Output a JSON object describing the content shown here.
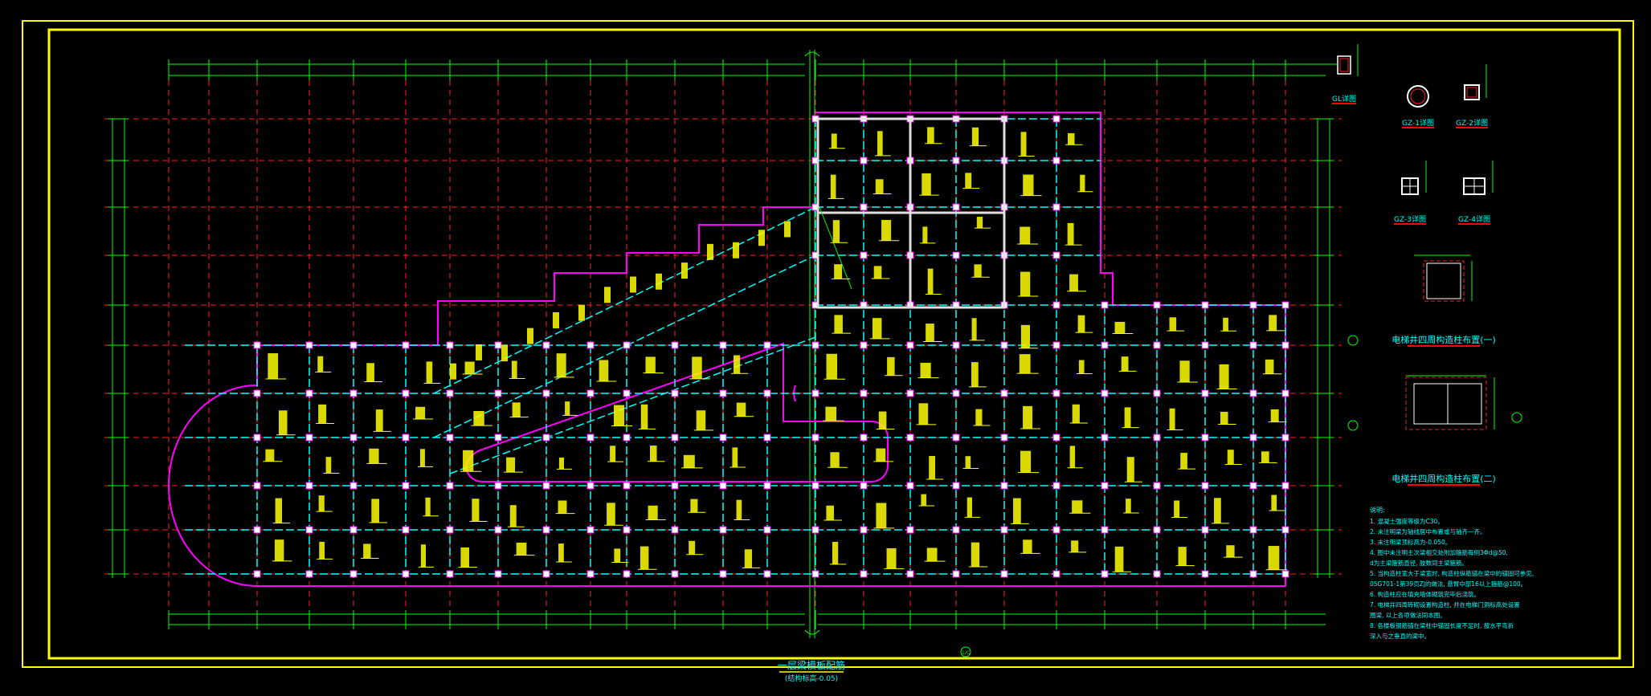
{
  "drawing": {
    "main_title": "一层梁模板配筋",
    "main_subtitle": "(结构标高-0.05)",
    "bubble_mark": "1/C",
    "colors": {
      "background": "#000000",
      "frame": "#ffff00",
      "grid": "#ff2020",
      "dimension": "#00ff00",
      "beam": "#00ffff",
      "wall": "#ff00ff",
      "text": "#ffff00",
      "column": "#ffffff",
      "title_underline": "#ff0000",
      "note_text": "#00ffff"
    }
  },
  "details": {
    "gl_title": "GL详图",
    "gz1_title": "GZ-1详图",
    "gz2_title": "GZ-2详图",
    "gz3_title": "GZ-3详图",
    "gz4_title": "GZ-4详图",
    "elevator1_title": "电梯井四周构造柱布置(一)",
    "elevator2_title": "电梯井四周构造柱布置(二)"
  },
  "notes": {
    "heading": "说明:",
    "items": [
      "1. 混凝土强度等级为C30。",
      "2. 未注明梁为轴线居中布置或与轴齐一齐。",
      "3. 未注明梁顶标高为-0.050。",
      "4. 图中未注明主次梁相交处附加箍筋每侧3Φd@50,",
      "   d为主梁箍筋直径, 肢数同主梁箍筋。",
      "5. 当构造柱宽大于梁宽时, 构造柱纵筋锚在梁中的锚固可参见,",
      "   05G701-1第39页ZJ的做法, 悬臂中部16以上箍筋@100。",
      "6. 构造柱应在填充墙体砌筑完毕后浇筑。",
      "7. 电梯井四周砖砌设置构造柱, 并在电梯门洞标高处设置",
      "   圈梁, 以上各项做法同本图。",
      "8. 各楼板钢筋锚在梁柱中锚固长度不足时, 按水平弯折",
      "   深入与之垂直的梁中。"
    ]
  }
}
